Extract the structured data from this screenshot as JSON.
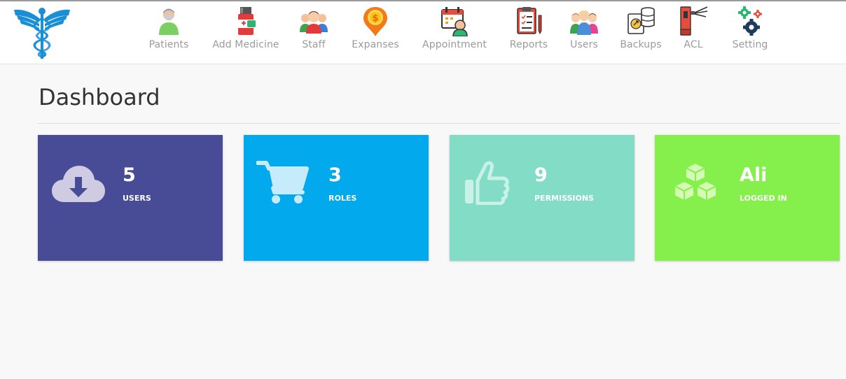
{
  "nav": {
    "items": [
      {
        "label": "Patients",
        "icon": "patient-icon"
      },
      {
        "label": "Add Medicine",
        "icon": "medicine-icon"
      },
      {
        "label": "Staff",
        "icon": "staff-icon"
      },
      {
        "label": "Expanses",
        "icon": "expenses-icon"
      },
      {
        "label": "Appointment",
        "icon": "appointment-icon"
      },
      {
        "label": "Reports",
        "icon": "reports-icon"
      },
      {
        "label": "Users",
        "icon": "users-icon"
      },
      {
        "label": "Backups",
        "icon": "backups-icon"
      },
      {
        "label": "ACL",
        "icon": "acl-icon"
      },
      {
        "label": "Setting",
        "icon": "settings-icon"
      }
    ]
  },
  "page": {
    "title": "Dashboard"
  },
  "cards": [
    {
      "value": "5",
      "label": "USERS",
      "icon": "cloud-download-icon",
      "color": "#484b96"
    },
    {
      "value": "3",
      "label": "ROLES",
      "icon": "cart-icon",
      "color": "#03a9ed"
    },
    {
      "value": "9",
      "label": "PERMISSIONS",
      "icon": "thumbs-up-icon",
      "color": "#82dcc6"
    },
    {
      "value": "Ali",
      "label": "LOGGED IN",
      "icon": "cubes-icon",
      "color": "#85f04b"
    }
  ]
}
